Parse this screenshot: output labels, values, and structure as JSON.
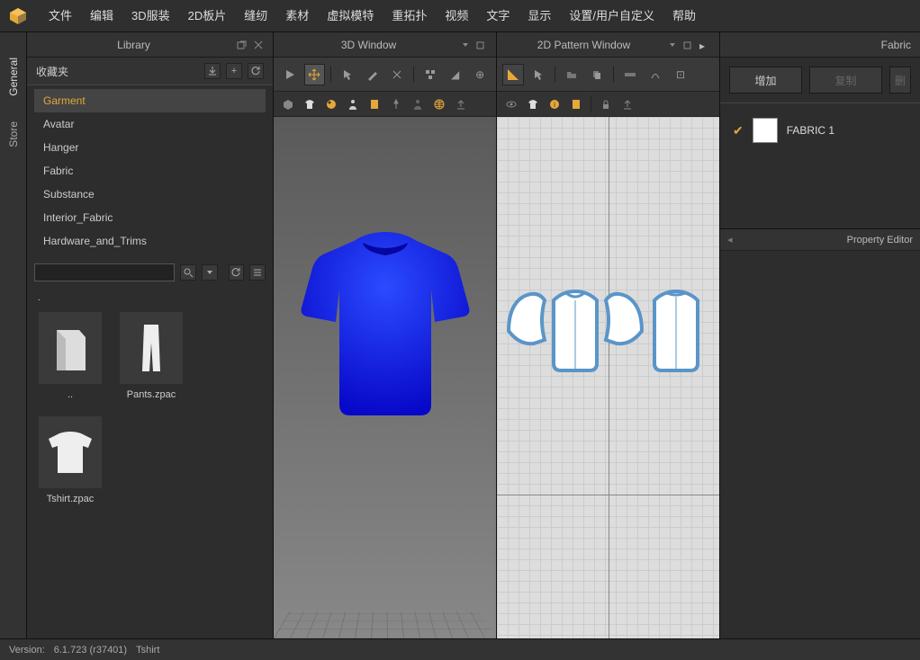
{
  "menu": [
    "文件",
    "编辑",
    "3D服装",
    "2D板片",
    "缝纫",
    "素材",
    "虚拟模特",
    "重拓扑",
    "视频",
    "文字",
    "显示",
    "设置/用户自定义",
    "帮助"
  ],
  "vtabs": [
    "General",
    "Store"
  ],
  "library": {
    "title": "Library",
    "favorites_label": "收藏夹",
    "categories": [
      "Garment",
      "Avatar",
      "Hanger",
      "Fabric",
      "Substance",
      "Interior_Fabric",
      "Hardware_and_Trims"
    ],
    "active_category": "Garment",
    "files": [
      {
        "name": ".."
      },
      {
        "name": "Pants.zpac"
      },
      {
        "name": "Tshirt.zpac"
      }
    ]
  },
  "window3d": {
    "title": "3D Window"
  },
  "window2d": {
    "title": "2D Pattern Window"
  },
  "fabric": {
    "title": "Fabric",
    "add_btn": "增加",
    "copy_btn": "复制",
    "del_btn": "删",
    "items": [
      {
        "name": "FABRIC 1",
        "checked": true,
        "color": "#ffffff"
      }
    ]
  },
  "prop_editor": {
    "title": "Property Editor"
  },
  "status": {
    "version_label": "Version:",
    "version": "6.1.723 (r37401)",
    "doc": "Tshirt"
  }
}
